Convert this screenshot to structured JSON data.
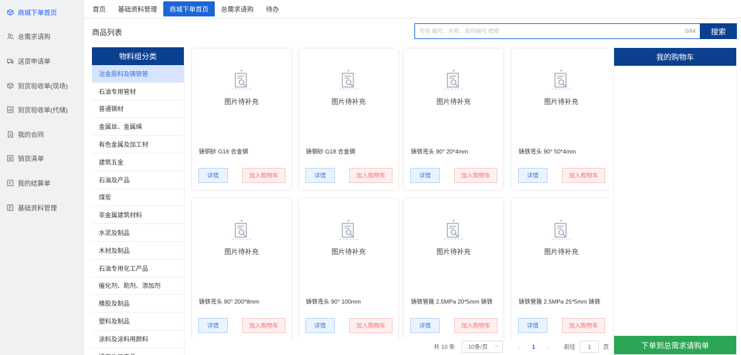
{
  "sidebar": {
    "items": [
      {
        "label": "商城下单首页",
        "icon": "cube-icon",
        "active": true
      },
      {
        "label": "总需求请购",
        "icon": "users-icon"
      },
      {
        "label": "送货申请单",
        "icon": "truck-icon"
      },
      {
        "label": "到货验收单(现场)",
        "icon": "box-icon"
      },
      {
        "label": "到货验收单(代储)",
        "icon": "chart-icon"
      },
      {
        "label": "我的合同",
        "icon": "file-icon"
      },
      {
        "label": "销货清单",
        "icon": "list-icon"
      },
      {
        "label": "我的结算单",
        "icon": "doc-icon"
      },
      {
        "label": "基础资料管理",
        "icon": "folder-icon"
      }
    ]
  },
  "tabs": [
    "首页",
    "基础资料管理",
    "商城下单首页",
    "总需求请购",
    "待办"
  ],
  "active_tab": 2,
  "main": {
    "title": "商品列表",
    "search": {
      "placeholder": "可按 编号、名称、类别编号 搜索",
      "counter": "0/64",
      "button": "搜索"
    }
  },
  "category": {
    "header": "物料组分类",
    "items": [
      "冶金原料及铸铁管",
      "石油专用管材",
      "普通钢材",
      "金属丝、金属绳",
      "有色金属及加工材",
      "建筑五金",
      "石油及产品",
      "煤炭",
      "非金属建筑材料",
      "水泥及制品",
      "木材及制品",
      "石油专用化工产品",
      "催化剂、助剂、添加剂",
      "橡胶及制品",
      "塑料及制品",
      "涂料及涂料用颜料",
      "通用化工产品"
    ]
  },
  "products": {
    "image_pending": "图片待补充",
    "detail_label": "详情",
    "add_cart_label": "加入购物车",
    "items": [
      {
        "name": "铸铜砂 G16 合金钢"
      },
      {
        "name": "铸钢砂 G18 合金钢"
      },
      {
        "name": "铸铁弯头 90° 20*4mm"
      },
      {
        "name": "铸铁弯头 90° 50*4mm"
      },
      {
        "name": "铸铁弯头 90° 200*8mm"
      },
      {
        "name": "铸铁弯头 90° 100mm"
      },
      {
        "name": "铸铁管箍 2.5MPa 20*5mm 铸铁"
      },
      {
        "name": "铸铁管箍 2.5MPa 25*5mm 铸铁"
      }
    ]
  },
  "pagination": {
    "total": "共 10 条",
    "page_size": "10条/页",
    "current": "1",
    "goto_label": "前往",
    "goto_value": "1",
    "page_unit": "页",
    "prev": "‹",
    "next": "›"
  },
  "cart": {
    "header": "我的购物车",
    "submit": "下单到总需求请购单"
  },
  "colors": {
    "primary": "#0b3f8f",
    "tab_active": "#1a66d6",
    "success": "#2aa655",
    "danger": "#f56c6c"
  }
}
